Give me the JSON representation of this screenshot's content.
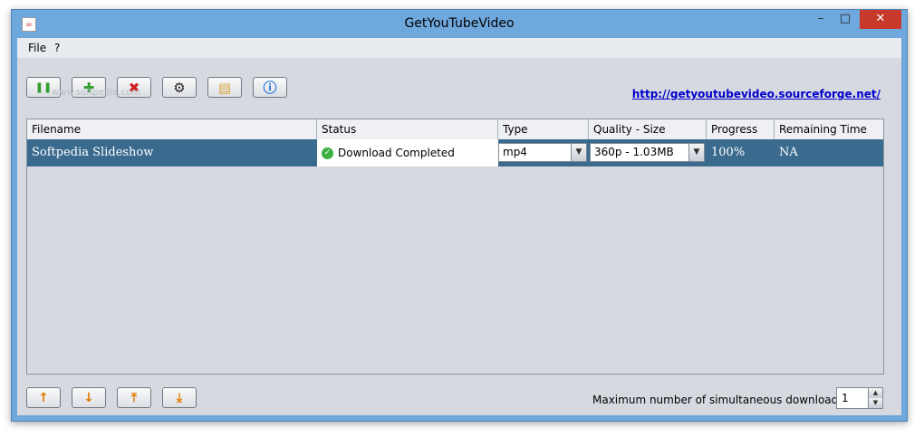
{
  "window": {
    "title": "GetYouTubeVideo",
    "min_glyph": "–",
    "max_glyph": "□",
    "close_glyph": "✕",
    "app_icon_glyph": "☕"
  },
  "menu": [
    {
      "label": "File"
    },
    {
      "label": "?"
    }
  ],
  "toolbar": {
    "buttons": [
      {
        "name": "pause-resume-button",
        "icon": "pause-icon",
        "glyph": "❚❚",
        "color": "#2f9e2f"
      },
      {
        "name": "add-button",
        "icon": "plus-icon",
        "glyph": "✚",
        "color": "#2f9e2f"
      },
      {
        "name": "remove-button",
        "icon": "red-x-icon",
        "glyph": "✖",
        "color": "#d21f1f"
      },
      {
        "name": "settings-button",
        "icon": "gear-icon",
        "glyph": "⚙",
        "color": "#222222"
      },
      {
        "name": "open-folder-button",
        "icon": "folder-icon",
        "glyph": "▤",
        "color": "#d9a43a"
      },
      {
        "name": "about-button",
        "icon": "info-icon",
        "glyph": "ⓘ",
        "color": "#1f6fd1"
      }
    ],
    "link": "http://getyoutubevideo.sourceforge.net/",
    "watermark": "www.softpedia.com"
  },
  "table": {
    "columns": [
      "Filename",
      "Status",
      "Type",
      "Quality - Size",
      "Progress",
      "Remaining Time"
    ],
    "rows": [
      {
        "filename": "Softpedia Slideshow",
        "status": "Download Completed",
        "type": "mp4",
        "quality_size": "360p - 1.03MB",
        "progress": "100%",
        "remaining": "NA"
      }
    ]
  },
  "bottom": {
    "nav_buttons": [
      {
        "name": "move-up-button",
        "icon": "arrow-up-icon",
        "glyph": "↑"
      },
      {
        "name": "move-down-button",
        "icon": "arrow-down-icon",
        "glyph": "↓"
      },
      {
        "name": "move-top-button",
        "icon": "arrow-top-icon",
        "glyph": "⤒"
      },
      {
        "name": "move-bottom-button",
        "icon": "arrow-bottom-icon",
        "glyph": "⤓"
      }
    ],
    "max_label": "Maximum number of simultaneous downloads :",
    "max_value": "1"
  }
}
